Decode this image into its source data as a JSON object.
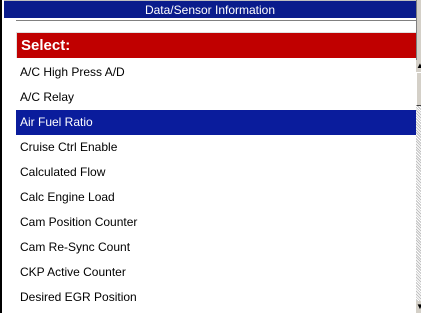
{
  "window": {
    "title": "Data/Sensor Information"
  },
  "header": {
    "select_label": "Select:"
  },
  "list": {
    "items": [
      {
        "label": "A/C High Press A/D",
        "selected": false
      },
      {
        "label": "A/C Relay",
        "selected": false
      },
      {
        "label": "Air Fuel Ratio",
        "selected": true
      },
      {
        "label": "Cruise Ctrl Enable",
        "selected": false
      },
      {
        "label": "Calculated Flow",
        "selected": false
      },
      {
        "label": "Calc Engine Load",
        "selected": false
      },
      {
        "label": "Cam Position Counter",
        "selected": false
      },
      {
        "label": "Cam Re-Sync Count",
        "selected": false
      },
      {
        "label": "CKP Active Counter",
        "selected": false
      },
      {
        "label": "Desired EGR Position",
        "selected": false
      }
    ]
  },
  "scrollbar": {
    "up_icon": "scroll-up-arrow",
    "down_icon": "scroll-down-arrow"
  },
  "colors": {
    "title_bar": "#0a1c8c",
    "select_header": "#c00000",
    "selection": "#0a1c9c"
  }
}
